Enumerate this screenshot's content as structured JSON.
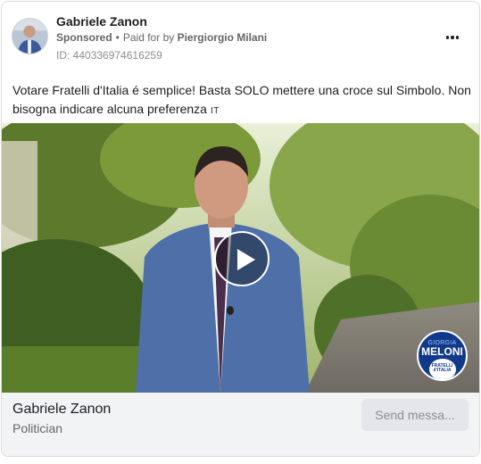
{
  "header": {
    "page_name": "Gabriele Zanon",
    "sponsored_label": "Sponsored",
    "separator": "•",
    "paid_for_prefix": "Paid for by",
    "payer_name": "Piergiorgio Milani",
    "ad_id": "ID: 440336974616259",
    "more_icon": "more-horizontal-icon"
  },
  "body": {
    "text": "Votare Fratelli d'Italia é semplice! Basta SOLO mettere una croce sul Simbolo. Non bisogna indicare alcuna preferenza",
    "language_tag": "IT"
  },
  "media": {
    "play_icon": "play-icon",
    "logo": {
      "top_text": "GIORGIA",
      "main_text": "MELONI",
      "bottom_text": "FRATELLI d'ITALIA"
    }
  },
  "footer": {
    "name": "Gabriele Zanon",
    "category": "Politician",
    "cta_label": "Send messa..."
  },
  "colors": {
    "text_primary": "#1c1e21",
    "text_secondary": "#65676b",
    "footer_bg": "#f2f3f5",
    "button_bg": "#e4e6eb",
    "logo_blue": "#123a8a"
  }
}
